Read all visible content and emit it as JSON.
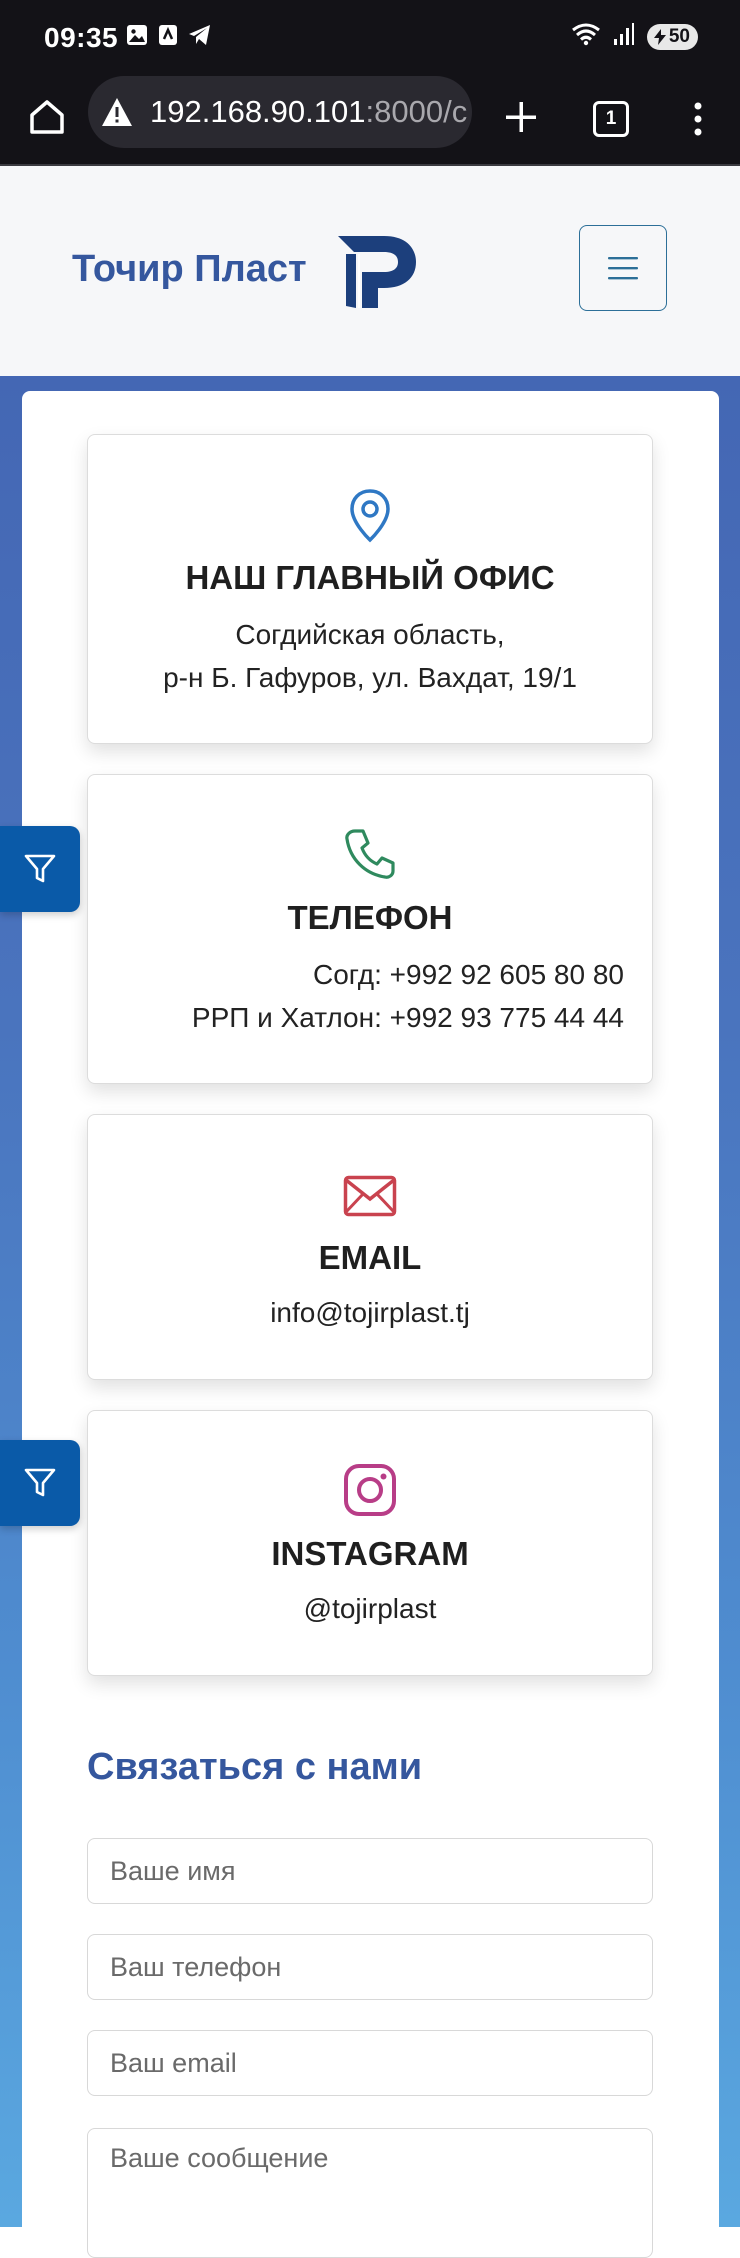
{
  "status_bar": {
    "time": "09:35",
    "battery": "50"
  },
  "browser": {
    "url_host": "192.168.90.101",
    "url_rest": ":8000/c",
    "tab_count": "1"
  },
  "header": {
    "brand_name": "Точир Пласт"
  },
  "cards": [
    {
      "icon": "map-pin-icon",
      "icon_color": "#2f78c4",
      "title": "НАШ ГЛАВНЫЙ ОФИС",
      "lines": [
        "Согдийская область,",
        "р-н Б. Гафуров, ул. Вахдат, 19/1"
      ]
    },
    {
      "icon": "phone-icon",
      "icon_color": "#2f8a5e",
      "title": "ТЕЛЕФОН",
      "lines": [
        "Согд: +992 92 605 80 80",
        "РРП и Хатлон: +992 93 775 44 44"
      ]
    },
    {
      "icon": "envelope-icon",
      "icon_color": "#c9434f",
      "title": "EMAIL",
      "lines": [
        "info@tojirplast.tj"
      ]
    },
    {
      "icon": "instagram-icon",
      "icon_color": "#b83d87",
      "title": "INSTAGRAM",
      "lines": [
        "@tojirplast"
      ]
    }
  ],
  "form": {
    "title": "Связаться с нами",
    "name_placeholder": "Ваше имя",
    "phone_placeholder": "Ваш телефон",
    "email_placeholder": "Ваш email",
    "message_placeholder": "Ваше сообщение"
  },
  "colors": {
    "brand_blue": "#35579e",
    "filter_tab": "#0a5aa8",
    "page_gradient_top": "#4467b4",
    "page_gradient_bottom": "#5aa8e0"
  }
}
